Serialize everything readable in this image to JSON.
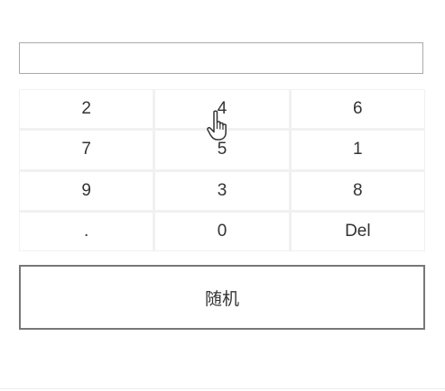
{
  "display": {
    "value": "",
    "placeholder": ""
  },
  "keypad": {
    "keys": [
      "2",
      "4",
      "6",
      "7",
      "5",
      "1",
      "9",
      "3",
      "8",
      ".",
      "0",
      "Del"
    ]
  },
  "random_button": {
    "label": "随机"
  },
  "cursor": {
    "icon": "hand-pointer-icon"
  }
}
